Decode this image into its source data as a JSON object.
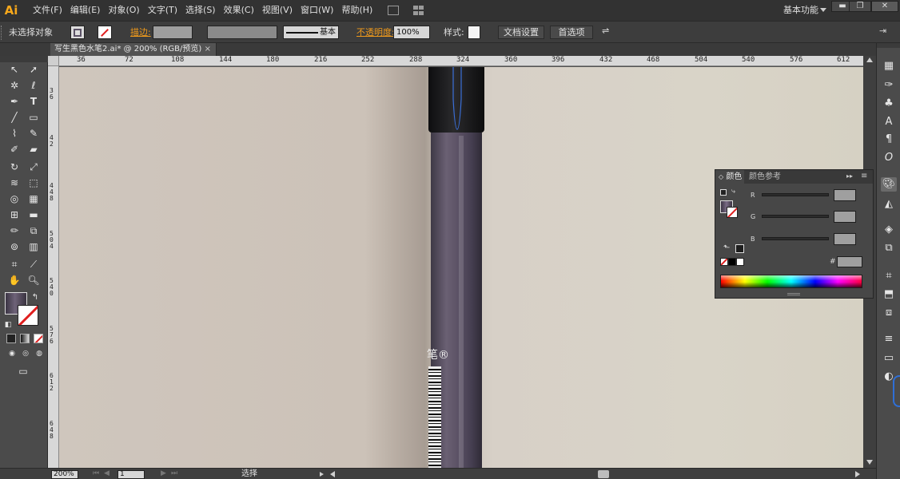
{
  "app": {
    "logo": "Ai",
    "menus": [
      "文件(F)",
      "编辑(E)",
      "对象(O)",
      "文字(T)",
      "选择(S)",
      "效果(C)",
      "视图(V)",
      "窗口(W)",
      "帮助(H)"
    ],
    "workspace": "基本功能",
    "window_buttons": [
      "▬",
      "❐",
      "✕"
    ]
  },
  "control_bar": {
    "selection_status": "未选择对象",
    "stroke_label": "描边:",
    "stroke_style": "基本",
    "opacity_label": "不透明度:",
    "opacity_value": "100%",
    "style_label": "样式:",
    "doc_setup_button": "文档设置",
    "preferences_button": "首选项"
  },
  "document": {
    "tab_title": "写生黑色水笔2.ai* @ 200% (RGB/预览)",
    "close_glyph": "×"
  },
  "rulers": {
    "top_ticks": [
      "36",
      "72",
      "108",
      "144",
      "180",
      "216",
      "252",
      "288",
      "324",
      "360",
      "396",
      "432",
      "468",
      "504",
      "540",
      "576",
      "612"
    ],
    "left_ticks": [
      "3",
      "6",
      "4",
      "2",
      "4",
      "4",
      "8",
      "5",
      "0",
      "4",
      "5",
      "4",
      "0",
      "5",
      "7",
      "6",
      "6",
      "1",
      "2",
      "6",
      "4",
      "8"
    ]
  },
  "canvas": {
    "brand_text": "笔®"
  },
  "status_bar": {
    "zoom": "200%",
    "page": "1",
    "mode": "选择"
  },
  "color_panel": {
    "tab_color": "颜色",
    "tab_guide": "颜色参考",
    "channels": [
      "R",
      "G",
      "B"
    ],
    "hex_label": "#"
  },
  "colors": {
    "menubar": "#323232",
    "panel": "#4b4b4b",
    "accent_orange": "#f09a1c"
  }
}
